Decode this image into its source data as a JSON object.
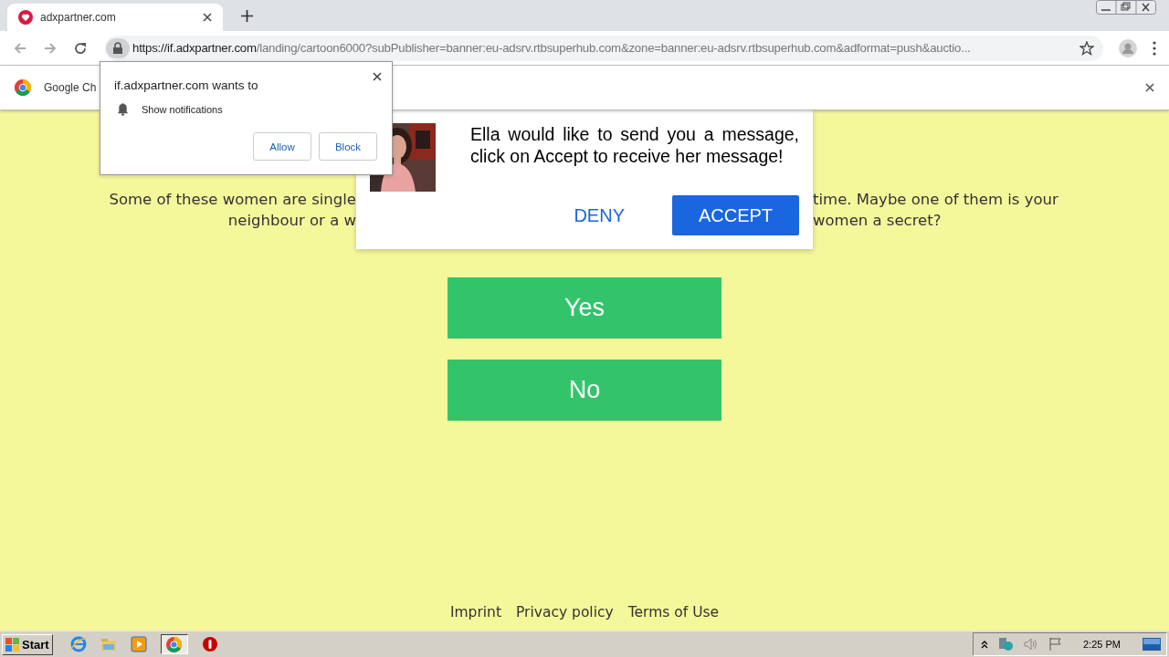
{
  "browser": {
    "tab": {
      "title": "adxpartner.com",
      "selected": true
    },
    "address": {
      "host": "https://if.adxpartner.com",
      "path": "/landing/cartoon6000?subPublisher=banner:eu-adsrv.rtbsuperhub.com&zone=banner:eu-adsrv.rtbsuperhub.com&adformat=push&auctio..."
    },
    "infobar": {
      "text": "Google Ch"
    }
  },
  "permission_prompt": {
    "title": "if.adxpartner.com wants to",
    "permission": "Show notifications",
    "buttons": [
      "Allow",
      "Block"
    ]
  },
  "page": {
    "paragraph_lines": [
      {
        "left": "Some of these women are single",
        "right": "time. Maybe one of them is your"
      },
      {
        "left": "neighbour or a w",
        "right": "women a secret?"
      }
    ],
    "answers": [
      "Yes",
      "No"
    ],
    "footer_links": [
      "Imprint",
      "Privacy policy",
      "Terms of Use"
    ]
  },
  "message_popup": {
    "message": "Ella would like to send you a message, click on Accept to receive her message!",
    "deny": "DENY",
    "accept": "ACCEPT"
  },
  "taskbar": {
    "start": "Start",
    "clock": "2:25 PM"
  }
}
